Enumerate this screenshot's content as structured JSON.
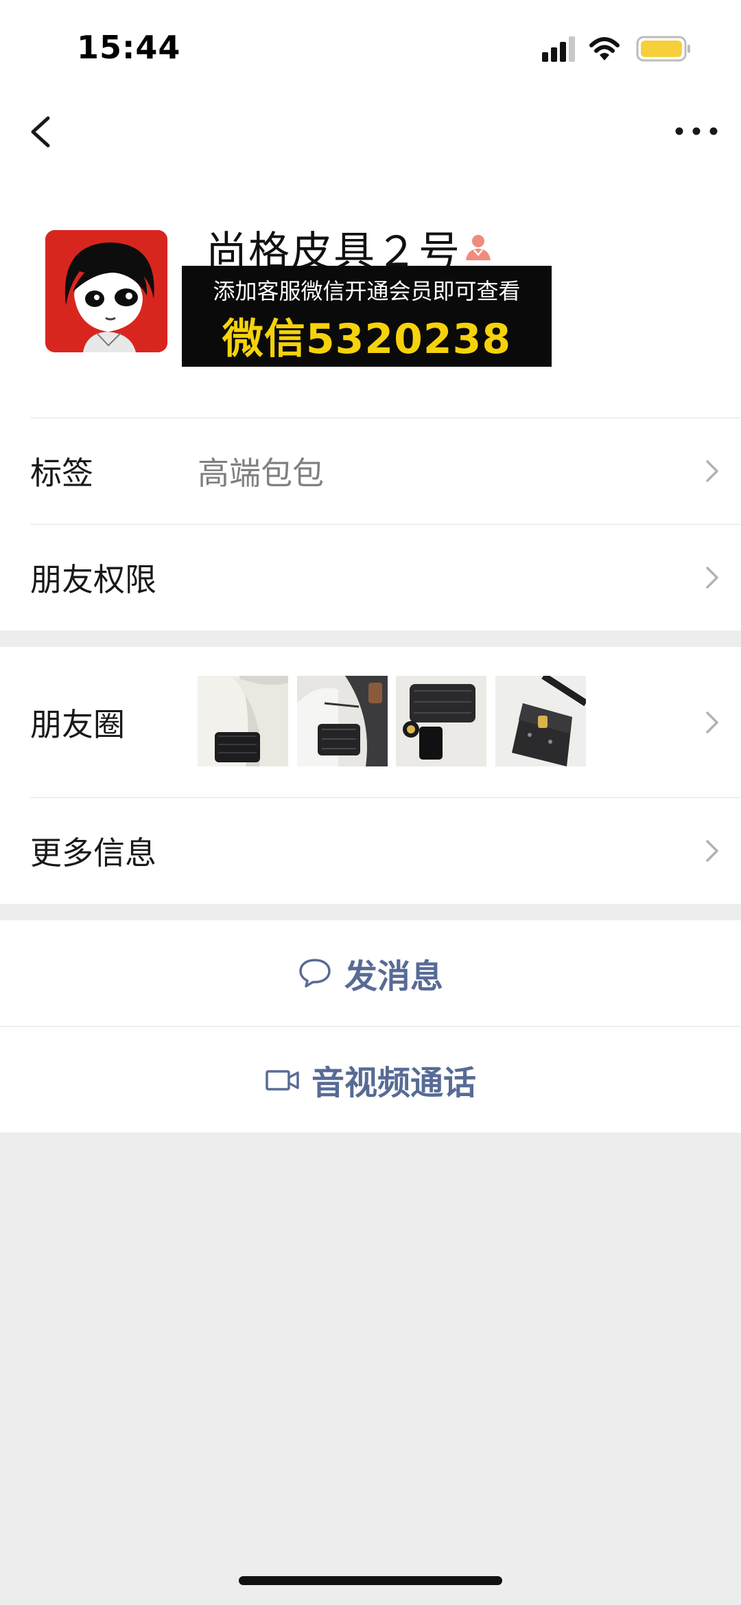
{
  "status_bar": {
    "time": "15:44"
  },
  "nav": {
    "back_icon": "chevron-left-icon",
    "more_icon": "ellipsis-icon"
  },
  "profile": {
    "name": "尚格皮具２号",
    "gender_icon": "female-person-icon",
    "promo_line1": "添加客服微信开通会员即可查看",
    "promo_line2": "微信5320238"
  },
  "info_rows": {
    "tag_label": "标签",
    "tag_value": "高端包包",
    "permissions_label": "朋友权限"
  },
  "moments": {
    "label": "朋友圈"
  },
  "more_info": {
    "label": "更多信息"
  },
  "actions": {
    "message_label": "发消息",
    "message_icon": "chat-bubble-icon",
    "call_label": "音视频通话",
    "call_icon": "video-camera-icon"
  },
  "colors": {
    "link_blue": "#576b95",
    "background": "#ededed",
    "promo_yellow": "#f5d20a"
  }
}
